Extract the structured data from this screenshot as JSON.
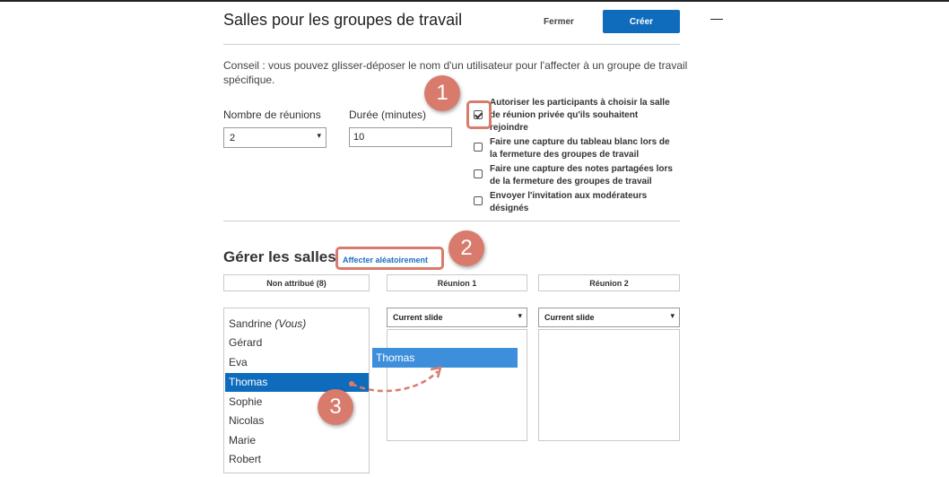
{
  "dialog": {
    "title": "Salles pour les groupes de travail",
    "close_label": "Fermer",
    "create_label": "Créer",
    "tip": "Conseil : vous pouvez glisser-déposer le nom d'un utilisateur pour l'affecter à un groupe de travail spécifique."
  },
  "settings": {
    "rooms_label": "Nombre de réunions",
    "rooms_value": "2",
    "duration_label": "Durée (minutes)",
    "duration_value": "10",
    "options": [
      {
        "label": "Autoriser les participants à choisir la salle de réunion privée qu'ils souhaitent rejoindre",
        "checked": true
      },
      {
        "label": "Faire une capture du tableau blanc lors de la fermeture des groupes de travail",
        "checked": false
      },
      {
        "label": "Faire une capture des notes partagées lors de la fermeture des groupes de travail",
        "checked": false
      },
      {
        "label": "Envoyer l'invitation aux modérateurs désignés",
        "checked": false
      }
    ]
  },
  "manage": {
    "title": "Gérer les salles",
    "random_link": "Affecter aléatoirement",
    "columns": [
      {
        "title": "Non attribué (8)"
      },
      {
        "title": "Réunion 1",
        "slide_select": "Current slide"
      },
      {
        "title": "Réunion 2",
        "slide_select": "Current slide"
      }
    ],
    "unassigned_users": [
      {
        "name": "Sandrine",
        "suffix": "(Vous)"
      },
      {
        "name": "Gérard"
      },
      {
        "name": "Eva"
      },
      {
        "name": "Thomas",
        "selected": true
      },
      {
        "name": "Sophie"
      },
      {
        "name": "Nicolas"
      },
      {
        "name": "Marie"
      },
      {
        "name": "Robert"
      }
    ],
    "dragging_user": "Thomas"
  },
  "annotations": {
    "step1": "1",
    "step2": "2",
    "step3": "3",
    "color": "#d97b6c"
  },
  "colors": {
    "primary": "#0f6cbd",
    "link": "#1a6fc4",
    "drag_chip": "#3d8fdc"
  }
}
